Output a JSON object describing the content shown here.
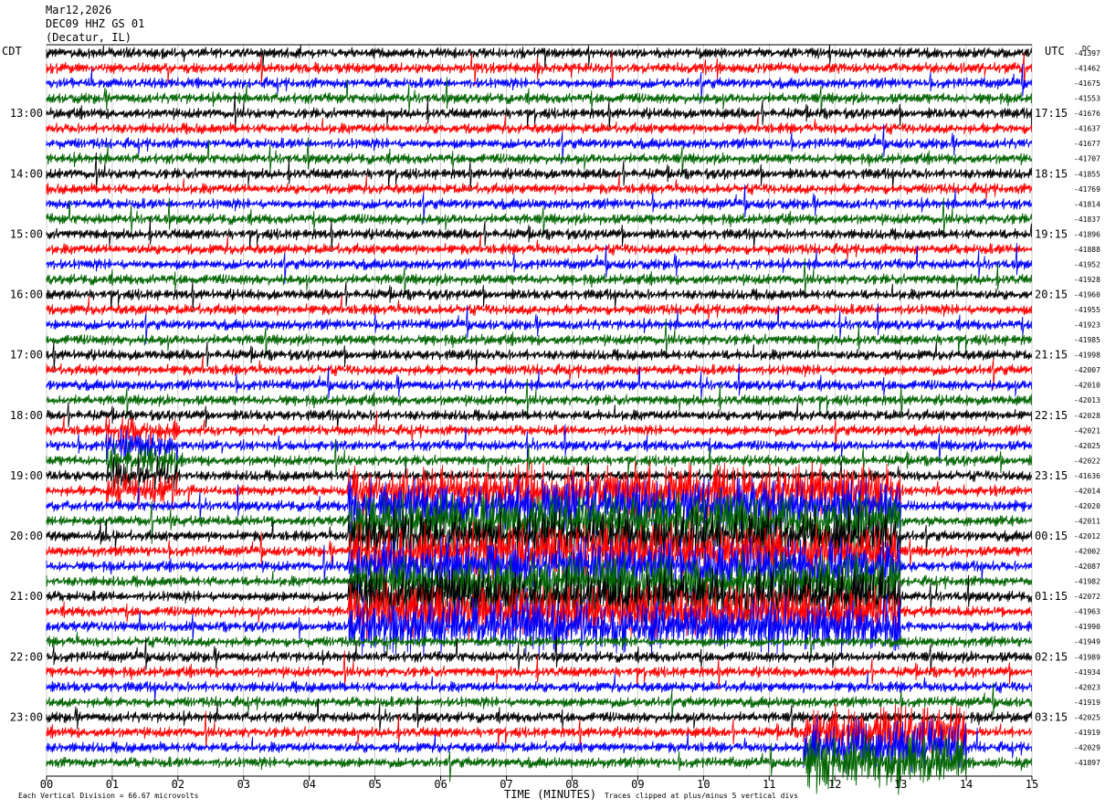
{
  "header": {
    "date": "Mar12,2026",
    "station": "DEC09 HHZ GS 01",
    "location": "(Decatur, IL)"
  },
  "left_tz": "CDT",
  "right_tz": "UTC",
  "dc_label": "DC",
  "colors": {
    "trace": [
      "#000000",
      "#ff0000",
      "#0000ff",
      "#006400"
    ]
  },
  "chart_data": {
    "type": "line",
    "xlabel": "TIME (MINUTES)",
    "xlim": [
      0,
      15
    ],
    "x_ticks": [
      "00",
      "01",
      "02",
      "03",
      "04",
      "05",
      "06",
      "07",
      "08",
      "09",
      "10",
      "11",
      "12",
      "13",
      "14",
      "15"
    ],
    "left_hour_labels": [
      "13:00",
      "14:00",
      "15:00",
      "16:00",
      "17:00",
      "18:00",
      "19:00",
      "20:00",
      "21:00",
      "22:00",
      "23:00"
    ],
    "right_hour_labels": [
      "17:15",
      "18:15",
      "19:15",
      "20:15",
      "21:15",
      "22:15",
      "23:15",
      "00:15",
      "01:15",
      "02:15",
      "03:15"
    ],
    "dc_offsets": [
      "-41397",
      "-41462",
      "-41675",
      "-41553",
      "-41676",
      "-41637",
      "-41677",
      "-41707",
      "-41855",
      "-41769",
      "-41814",
      "-41837",
      "-41896",
      "-41888",
      "-41952",
      "-41928",
      "-41960",
      "-41955",
      "-41923",
      "-41985",
      "-41998",
      "-42007",
      "-42010",
      "-42013",
      "-42028",
      "-42021",
      "-42025",
      "-42022",
      "-41636",
      "-42014",
      "-42020",
      "-42011",
      "-42012",
      "-42002",
      "-42087",
      "-41982",
      "-42072",
      "-41963",
      "-41990",
      "-41949",
      "-41989",
      "-41934",
      "-42023",
      "-41919",
      "-42025",
      "-41919",
      "-42029",
      "-41897"
    ],
    "traces_per_hour": 4,
    "minutes_per_trace": 15,
    "notes": {
      "footer_left": "Each Vertical Division =   66.67 microvolts",
      "footer_right": "Traces clipped at plus/minus 5 vertical divs"
    }
  }
}
